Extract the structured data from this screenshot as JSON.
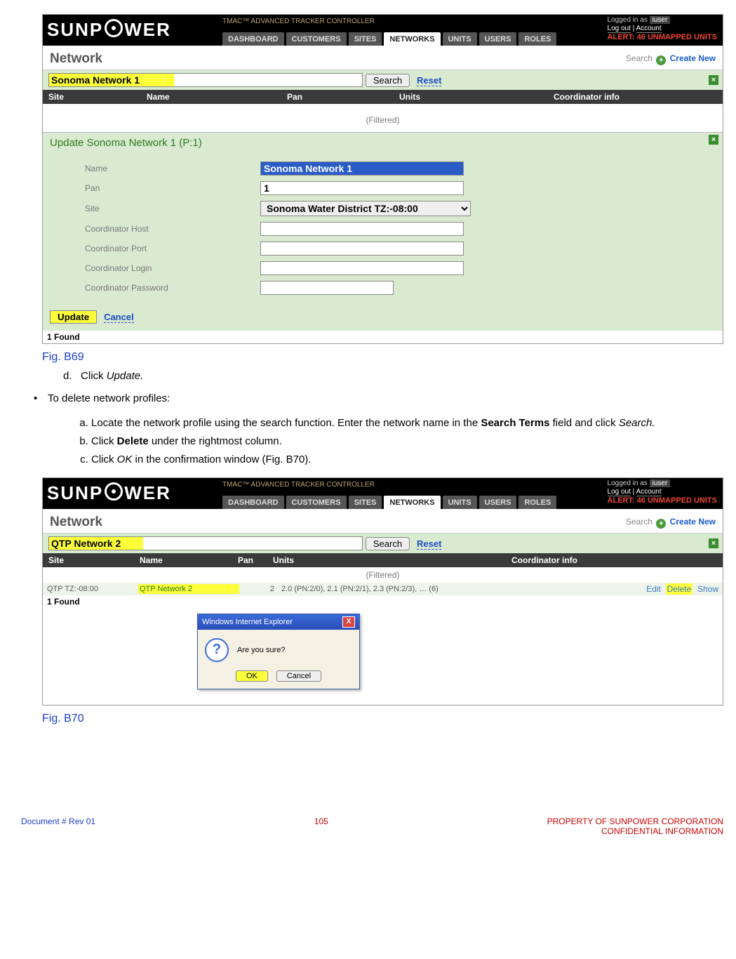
{
  "header": {
    "logo_text": "SUNPOWER",
    "tmac": "TMAC™ ADVANCED TRACKER CONTROLLER",
    "tabs": [
      "DASHBOARD",
      "CUSTOMERS",
      "SITES",
      "NETWORKS",
      "UNITS",
      "USERS",
      "ROLES"
    ],
    "active_tab": "NETWORKS",
    "logged_in_as": "Logged in as",
    "username": "iuser",
    "logout": "Log out",
    "account": "Account",
    "alert": "ALERT: 46 UNMAPPED UNITS"
  },
  "titlebar": {
    "title": "Network",
    "search_label": "Search",
    "create_label": "Create New"
  },
  "screenshot1": {
    "search_value": "Sonoma Network 1",
    "search_btn": "Search",
    "reset": "Reset",
    "columns": [
      "Site",
      "Name",
      "Pan",
      "Units",
      "Coordinator info"
    ],
    "filtered": "(Filtered)",
    "update_title": "Update Sonoma Network 1 (P:1)",
    "form": {
      "name_label": "Name",
      "name_value": "Sonoma Network 1",
      "pan_label": "Pan",
      "pan_value": "1",
      "site_label": "Site",
      "site_value": "Sonoma Water District TZ:-08:00",
      "host_label": "Coordinator Host",
      "port_label": "Coordinator Port",
      "login_label": "Coordinator Login",
      "pass_label": "Coordinator Password"
    },
    "update_btn": "Update",
    "cancel": "Cancel",
    "found": "1 Found"
  },
  "doc": {
    "fig69": "Fig. B69",
    "step_d_prefix": "d.",
    "step_d_pre": "Click ",
    "step_d_em": "Update.",
    "bullet_text": "To delete network profiles:",
    "step_a_pre": "Locate the network profile using the search function. Enter the network name in the ",
    "step_a_bold": "Search Terms",
    "step_a_post": " field and click ",
    "step_a_em": "Search.",
    "step_b_pre": "Click ",
    "step_b_bold": "Delete",
    "step_b_post": " under the rightmost column.",
    "step_c_pre": "Click ",
    "step_c_em": "OK",
    "step_c_post": " in the confirmation window (Fig. B70).",
    "fig70": "Fig. B70"
  },
  "screenshot2": {
    "search_value": "QTP Network 2",
    "search_btn": "Search",
    "reset": "Reset",
    "columns": [
      "Site",
      "Name",
      "Pan",
      "Units",
      "Coordinator info"
    ],
    "filtered": "(Filtered)",
    "row": {
      "site": "QTP TZ:-08:00",
      "name": "QTP Network 2",
      "pan": "2",
      "units": "2.0 (PN:2/0), 2.1 (PN:2/1), 2.3 (PN:2/3), … (6)",
      "edit": "Edit",
      "delete": "Delete",
      "show": "Show"
    },
    "found": "1 Found",
    "dialog": {
      "title": "Windows Internet Explorer",
      "msg": "Are you sure?",
      "ok": "OK",
      "cancel": "Cancel"
    }
  },
  "footer": {
    "left": "Document #  Rev 01",
    "center": "105",
    "right1": "PROPERTY OF SUNPOWER CORPORATION",
    "right2": "CONFIDENTIAL INFORMATION"
  }
}
